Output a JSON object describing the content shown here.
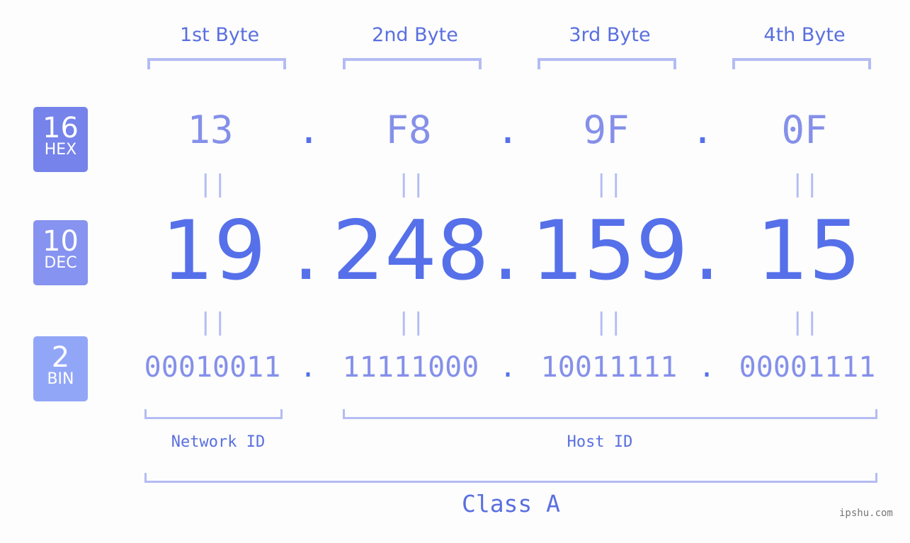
{
  "byte_headers": [
    "1st Byte",
    "2nd Byte",
    "3rd Byte",
    "4th Byte"
  ],
  "badges": {
    "hex": {
      "base": "16",
      "label": "HEX",
      "color": "#7583ea"
    },
    "dec": {
      "base": "10",
      "label": "DEC",
      "color": "#8693f0"
    },
    "bin": {
      "base": "2",
      "label": "BIN",
      "color": "#92a6f8"
    }
  },
  "hex_values": [
    "13",
    "F8",
    "9F",
    "0F"
  ],
  "dec_values": [
    "19",
    "248",
    "159",
    "15"
  ],
  "bin_values": [
    "00010011",
    "11111000",
    "10011111",
    "00001111"
  ],
  "separator": ".",
  "equals_sign": "=",
  "network_id_label": "Network ID",
  "host_id_label": "Host ID",
  "class_label": "Class A",
  "watermark": "ipshu.com",
  "colors": {
    "primary": "#5670ea",
    "light": "#8590ea",
    "bracket": "#b4bcf4"
  }
}
